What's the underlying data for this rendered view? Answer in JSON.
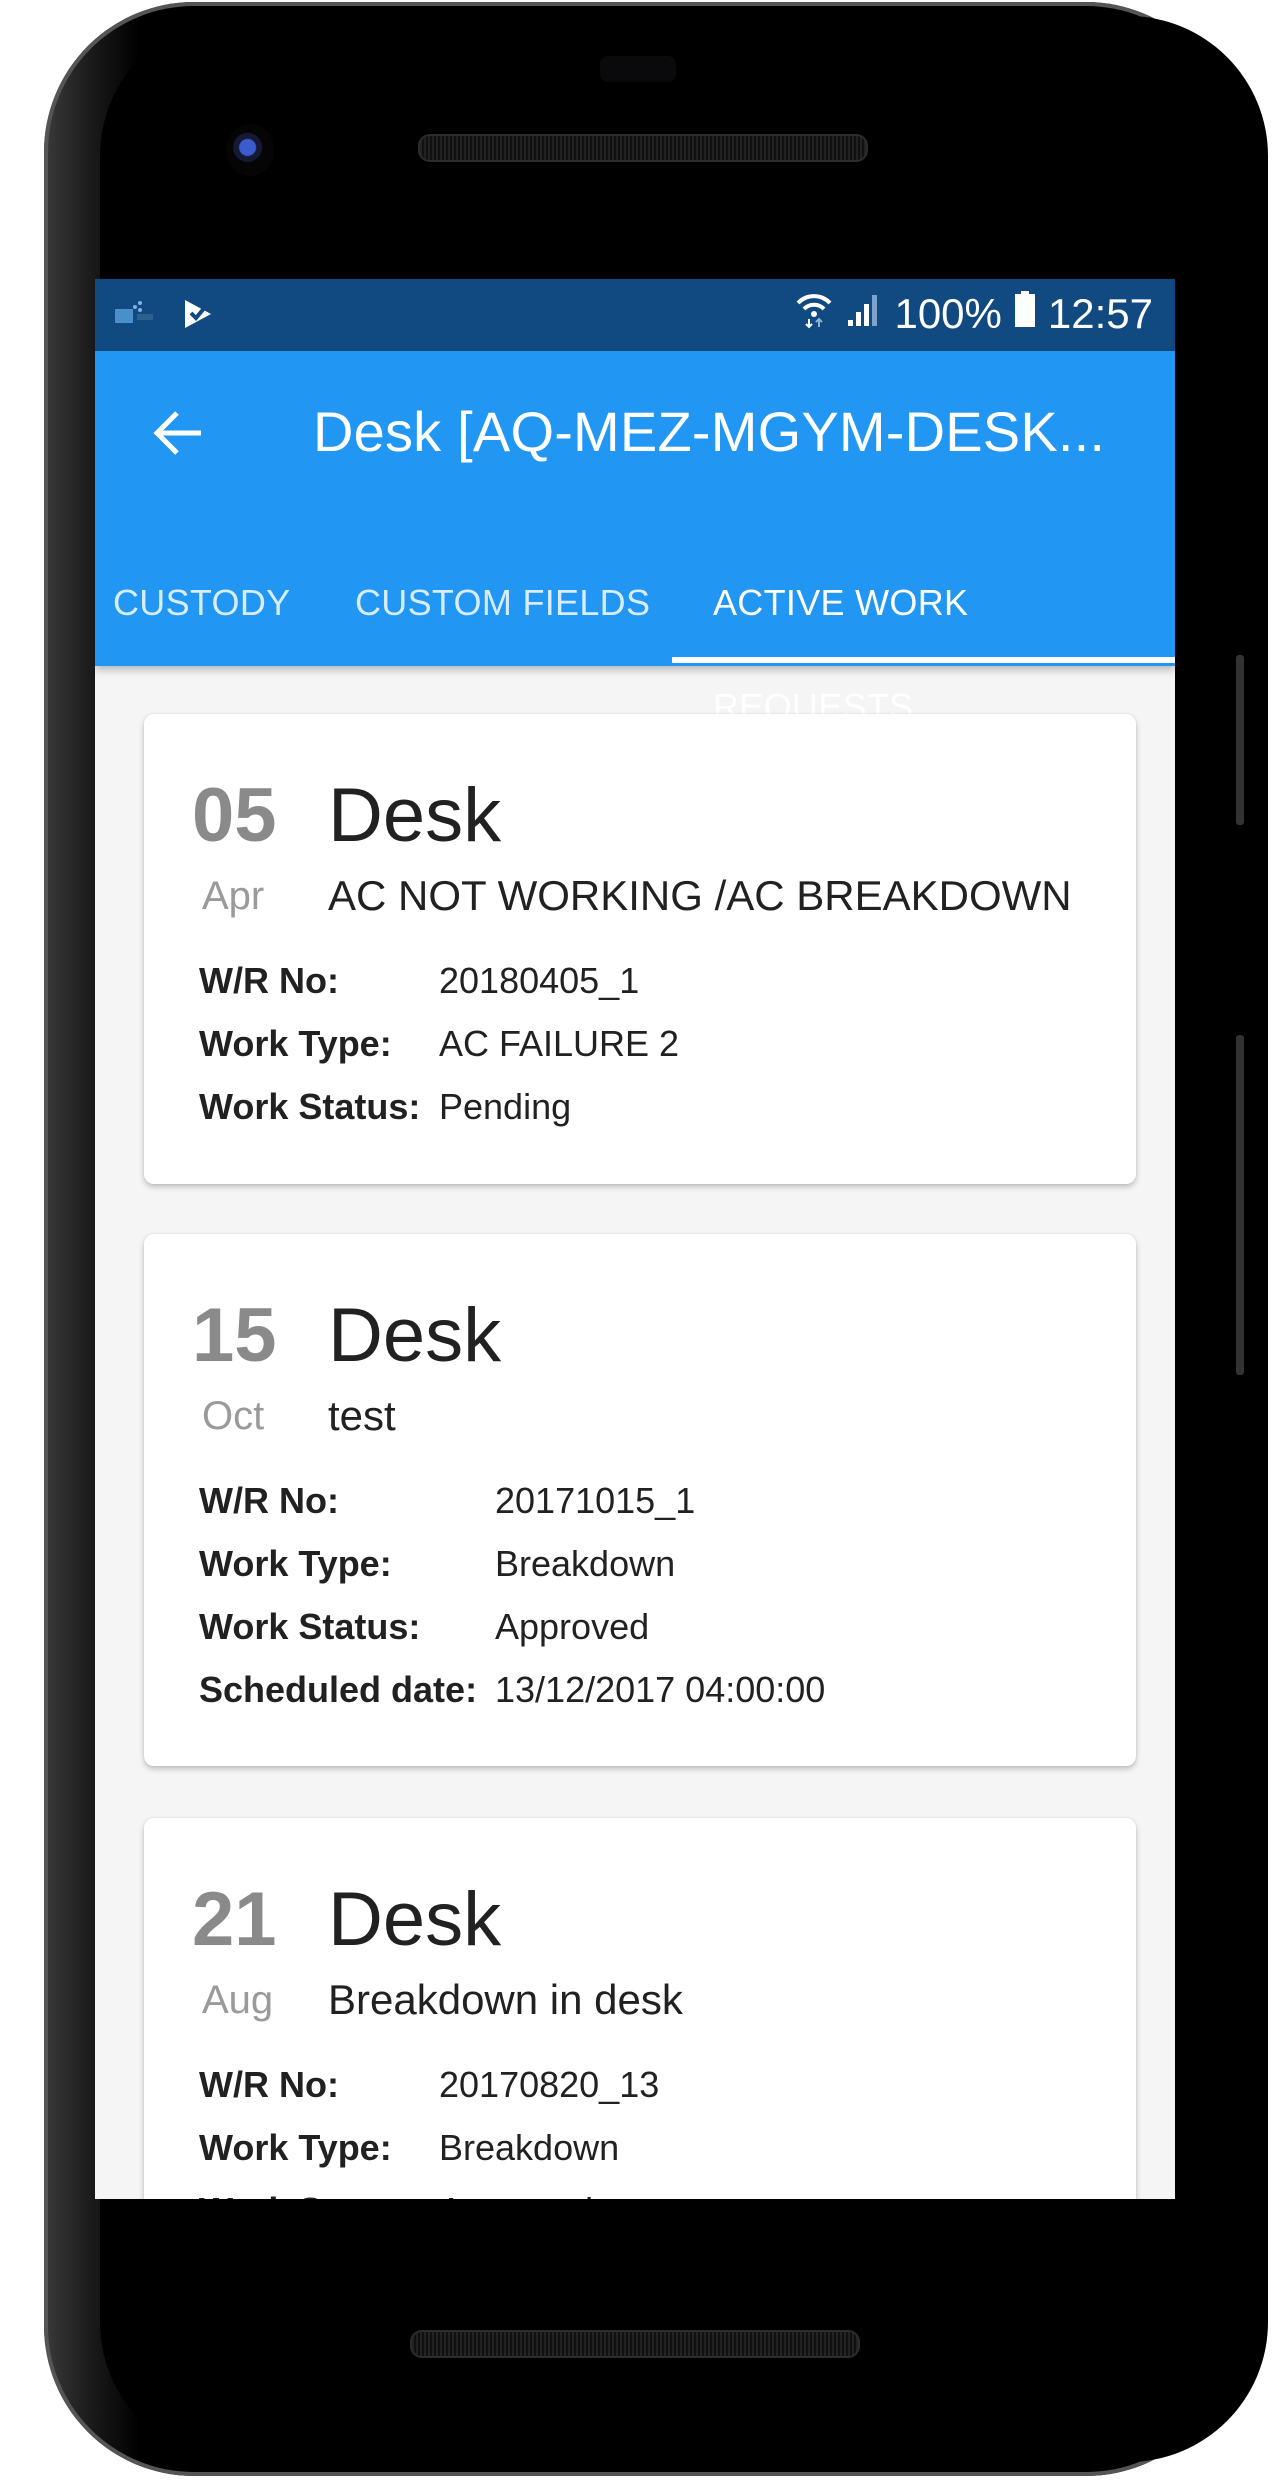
{
  "status_bar": {
    "notification_icons": [
      "aladdin-app-icon",
      "play-store-icon"
    ],
    "wifi": "wifi-icon",
    "signal": "signal-icon",
    "battery_percent": "100%",
    "time": "12:57"
  },
  "app_bar": {
    "title": "Desk [AQ-MEZ-MGYM-DESK...",
    "back_icon": "arrow-left-icon"
  },
  "tabs": [
    {
      "label": "CUSTODY",
      "active": false
    },
    {
      "label": "CUSTOM FIELDS",
      "active": false
    },
    {
      "label": "ACTIVE WORK REQUESTS",
      "active": true
    }
  ],
  "colors": {
    "status_bar": "#114a80",
    "app_bar": "#2196f3",
    "background": "#f5f5f5",
    "day_text": "#8a8a8a"
  },
  "work_requests": [
    {
      "day": "05",
      "month": "Apr",
      "asset": "Desk",
      "description": "AC NOT WORKING /AC BREAKDOWN",
      "fields": [
        {
          "label": "W/R No:",
          "value": "20180405_1"
        },
        {
          "label": "Work Type:",
          "value": "AC FAILURE 2"
        },
        {
          "label": "Work Status:",
          "value": "Pending"
        }
      ]
    },
    {
      "day": "15",
      "month": "Oct",
      "asset": "Desk",
      "description": "test",
      "fields": [
        {
          "label": "W/R No:",
          "value": "20171015_1"
        },
        {
          "label": "Work Type:",
          "value": "Breakdown"
        },
        {
          "label": "Work Status:",
          "value": "Approved"
        },
        {
          "label": "Scheduled date:",
          "value": "13/12/2017 04:00:00"
        }
      ]
    },
    {
      "day": "21",
      "month": "Aug",
      "asset": "Desk",
      "description": "Breakdown in desk",
      "fields": [
        {
          "label": "W/R No:",
          "value": "20170820_13"
        },
        {
          "label": "Work Type:",
          "value": "Breakdown"
        },
        {
          "label": "Work Status:",
          "value": "Approved"
        }
      ]
    }
  ]
}
